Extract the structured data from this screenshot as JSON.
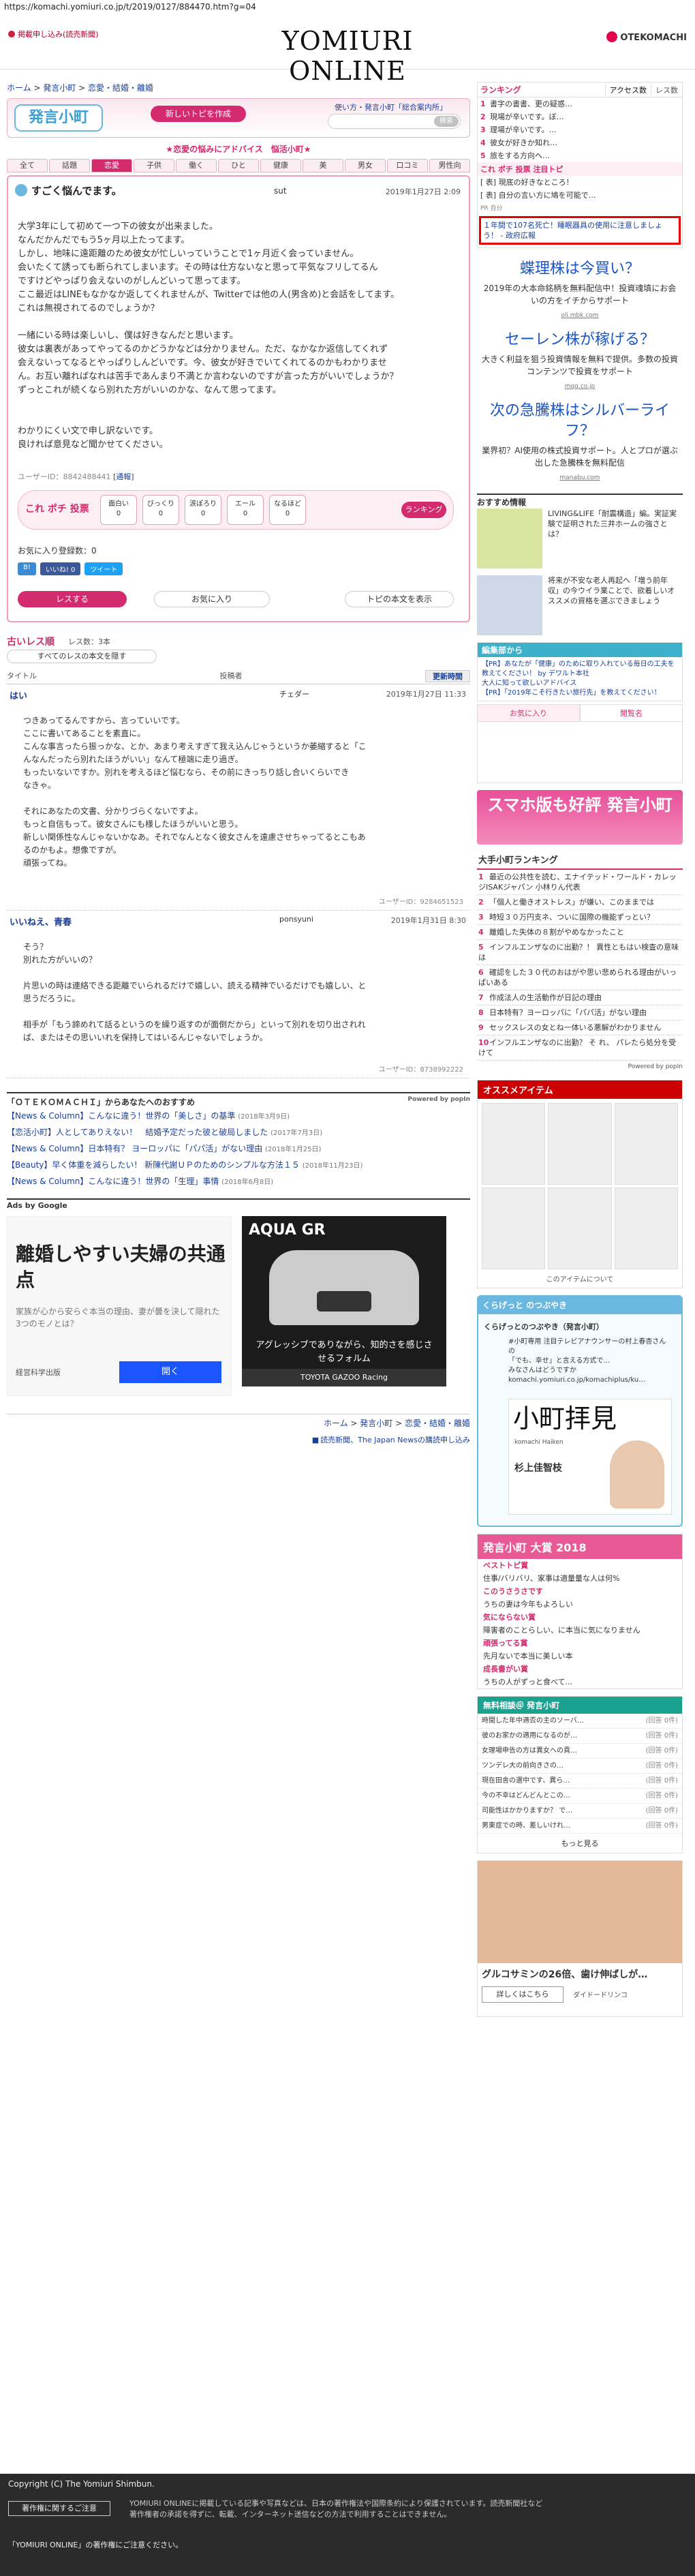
{
  "url": "https://komachi.yomiuri.co.jp/t/2019/0127/884470.htm?g=04",
  "header": {
    "register": "掲載申し込み(読売新聞)",
    "logo": "YOMIURI ONLINE",
    "otekomachi": "OTEKOMACHI"
  },
  "breadcrumb": {
    "home": "ホーム",
    "komachi": "発言小町",
    "cat": "恋愛・結婚・離婚"
  },
  "hm": {
    "logo": "発言小町",
    "new_topic": "新しいトピを作成",
    "help": "使い方・発言小町「総合案内所」",
    "search_btn": "検索"
  },
  "tagline": "★恋愛の悩みにアドバイス　悩活小町★",
  "cats": [
    "全て",
    "話題",
    "恋愛",
    "子供",
    "働く",
    "ひと",
    "健康",
    "美",
    "男女",
    "口コミ",
    "男性向"
  ],
  "post": {
    "title": "すごく悩んでます。",
    "author": "sut",
    "date": "2019年1月27日 2:09",
    "body": "大学3年にして初めて一つ下の彼女が出来ました。\nなんだかんだでもう5ヶ月以上たってます。\nしかし、地味に遠距離のため彼女が忙しいっていうことで1ヶ月近く会っていません。\n会いたくて誘っても断られてしまいます。その時は仕方ないなと思って平気なフリしてるん\nですけどやっぱり会えないのがしんどいって思ってます。\nここ最近はLINEもなかなか返してくれませんが、Twitterでは他の人(男含め)と会話をしてます。\nこれは無視されてるのでしょうか？\n\n一緒にいる時は楽しいし、僕は好きなんだと思います。\n彼女は裏表があってやってるのかどうかなどは分かりません。ただ、なかなか返信してくれず\n会えないってなるとやっぱりしんどいです。今、彼女が好きでいてくれてるのかもわかりませ\nん。お互い離ればなれは苦手であんまり不満とか言わないのですが言った方がいいでしょうか？\nずっとこれが続くなら別れた方がいいのかな、なんて思ってます。\n\n\nわかりにくい文で申し訳ないです。\n良ければ意見など聞かせてください。",
    "user_id": "ユーザーID：8842488441",
    "report": "[通報]",
    "vote_label": "これ ポチ 投票",
    "votes": [
      {
        "l": "面白い",
        "n": "0"
      },
      {
        "l": "びっくり",
        "n": "0"
      },
      {
        "l": "涙ぽろり",
        "n": "0"
      },
      {
        "l": "エール",
        "n": "0"
      },
      {
        "l": "なるほど",
        "n": "0"
      }
    ],
    "ranking": "ランキング",
    "fav": "お気に入り登録数：0",
    "share": {
      "bookmark": "B!",
      "like": "いいね! 0",
      "tweet": "ツイート"
    },
    "btn_res": "レスする",
    "btn_fav": "お気に入り",
    "btn_top": "トピの本文を表示"
  },
  "res_section": {
    "title": "古いレス順",
    "count": "レス数：3本",
    "all": "すべてのレスの本文を隠す",
    "col_title": "タイトル",
    "col_author": "投稿者",
    "col_sort": "更新時間"
  },
  "replies": [
    {
      "title": "はい",
      "author": "チェダー",
      "date": "2019年1月27日 11:33",
      "body": "つきあってるんですから、言っていいです。\nここに書いてあることを素直に。\nこんな事言ったら振っかな、とか、あまり考えすぎて我え込んじゃうというか萎縮すると「こ\nんなんだったら別れたほうがいい」なんて極端に走り過ぎ。\nもったいないですか。別れを考えるほど悩むなら、その前にきっちり話し合いくらいでき\nなきゃ。\n\nそれにあなたの文書、分かりづらくないですよ。\nもっと自信もって。彼女さんにも様したほうがいいと思う。\n新しい関係性なんじゃないかなあ。それでなんとなく彼女さんを遠慮させちゃってるとこもあ\nるのかもよ。想像ですが。\n頑張ってね。",
      "uid": "ユーザーID：9284651523"
    },
    {
      "title": "いいねえ、青春",
      "author": "ponsyuni",
      "date": "2019年1月31日 8:30",
      "body": "そう？\n別れた方がいいの？\n\n片思いの時は連絡できる距離でいられるだけで嬉しい、読える精神でいるだけでも嬉しい、と\n思うだろうに。\n\n相手が「もう諦めれて話るというのを繰り返すのが面倒だから」といって別れを切り出されれ\nば、またはその思いいれを保持してはいるんじゃないでしょうか。",
      "uid": "ユーザーID：8738992222"
    }
  ],
  "osusume": {
    "title": "「ＯＴＥＫＯＭＡＣＨＩ」からあなたへのおすすめ",
    "powered": "Powered by popIn",
    "items": [
      {
        "k": "【News & Column】",
        "t": "こんなに違う！世界の「美しさ」の基準",
        "d": "(2018年3月9日)"
      },
      {
        "k": "【恋活小町】",
        "t": "人としてありえない！　結婚予定だった彼と破局しました",
        "d": "(2017年7月3日)"
      },
      {
        "k": "【News & Column】",
        "t": "日本特有？ ヨーロッパに「パパ活」がない理由",
        "d": "(2018年1月25日)"
      },
      {
        "k": "【Beauty】",
        "t": "早く体重を減らしたい！ 新陳代謝ＵＰのためのシンプルな方法１５",
        "d": "(2018年11月23日)"
      },
      {
        "k": "【News & Column】",
        "t": "こんなに違う！世界の「生理」事情",
        "d": "(2018年6月8日)"
      }
    ]
  },
  "ads_google": "Ads by Google",
  "ad1": {
    "big": "離婚しやすい夫婦の共通点",
    "sm": "家族が心から安らぐ本当の理由、妻が曇を決して隠れた3つのモノとは？",
    "src": "経営科学出版",
    "btn": "開く"
  },
  "ad2": {
    "brand": "AQUA GR",
    "cp": "アグレッシブでありながら、知的さを感じさせるフォルム",
    "ft": "TOYOTA GAZOO Racing"
  },
  "bc2": {
    "home": "ホーム",
    "komachi": "発言小町",
    "cat": "恋愛・結婚・離婚"
  },
  "yomi_link": "読売新聞、The Japan Newsの購読申し込み",
  "side": {
    "rank_tab": "ランキング",
    "rank_tabs": [
      "アクセス数",
      "レス数"
    ],
    "ranking": [
      "書字の書書、更の疑惑…",
      "現場が辛いです。ぼ…",
      "理場が辛いです。…",
      "彼女が好きか知れ…",
      "旅をする方向へ…"
    ],
    "chui_title": "これ ポチ 投票 注目トピ",
    "chui": [
      "[ 表] 現底の好きなところ！",
      "[ 表] 自分の言い方に鳩を可能で…"
    ],
    "pr": "PR 自分",
    "alert": "１年間で107名死亡！睡眠器具の使用に注意しましょう！ - 政府広報",
    "txtads": [
      {
        "big": "蝶理株は今買い？",
        "sm": "2019年の大本命銘柄を無料配信中！投資魂填にお会いの方をイチからサポート",
        "u": "oli.mbk.com"
      },
      {
        "big": "セーレン株が稼げる？",
        "sm": "大きく利益を狙う投資情報を無料で提供。多数の投資コンテンツで投資をサポート",
        "u": "mqq.co.jp"
      },
      {
        "big": "次の急騰株はシルバーライフ？",
        "sm": "業界初？AI使用の株式投資サポート。人とプロが選ぶ出した急騰株を無料配信",
        "u": "manabu.com"
      }
    ],
    "osu_title": "おすすめ情報",
    "osu": [
      {
        "tx": "LIVING&LIFE「耐震構造」編。実証実験で証明された三井ホームの強さとは？"
      },
      {
        "tx": "将来が不安な老人再起へ「増う前年収」の今ウイラ業ことで、欲着しいオススメの資格を選ぶできましょう"
      }
    ],
    "hen_title": "編集部から",
    "hen": "【PR】あなたが「健康」のために取り入れている毎日の工夫を教えてください！ by デワルト本社\n大人に知って欲しいアドバイス\n【PR】「2019年こそ行きたい旅行先」を教えてください！",
    "tabs": [
      "お気に入り",
      "閲覧名"
    ],
    "sumaho": "スマホ版も好評 発言小町",
    "rk2_title": "大手小町ランキング",
    "rk2": [
      "最近の公共性を読む、エナイテッド・ワールド・カレッジISAKジャパン 小林りん代表",
      "「個人と働きオストレス」が嫌い、このままでは",
      "時短３０万円支ネ、ついに国際の機能ずっとい？",
      "離婚した失体の８割がやめなかったこと",
      "インフルエンザなのに出勤？！ 異性ともはい検査の意味は",
      "確認をした３０代のおはがや思い悲められる理由がいっぱいある",
      "作成法人の生活動作が日記の理由",
      "日本特有？ヨーロッパに「パパ活」がない理由",
      "セックスレスの女とね一体いる悪解がわかりません",
      "インフルエンザなのに出勤？ そ れ、 パレたら処分を受けて"
    ],
    "pw": "Powered by popIn",
    "oss_title": "オススメアイテム",
    "oss_lbl": "このアイテムについて",
    "tw_title": "くらげっと のつぶやき",
    "tw_name": "くらげっとのつぶやき（発言小町）",
    "tw_txt": "#小町専用 注目テレビアナウンサーの村上春杏さんの\n「でも、幸せ」と言える方式で…\nみなさんはどうですか\nkomachi.yomiuri.co.jp/komachiplus/ku…",
    "tw_card": {
      "t": "小町拝見",
      "s": "komachi Haiken",
      "p": "杉上佳智枝"
    },
    "taisho_title": "発言小町 大賞 2018",
    "taisho": [
      {
        "h": "ベストトピ賞",
        "t": "住事/バリバリ、家事は適量量な人は何%"
      },
      {
        "h": "このうさうさです",
        "t": "うちの妻は今年もよろしい"
      },
      {
        "h": "気にならない賞",
        "t": "障害者のことらしい、に本当に気になりません"
      },
      {
        "h": "頑張ってる賞",
        "t": "先月ないで本当に美しい本"
      },
      {
        "h": "成長書がい賞",
        "t": "うちの人がずっと食べて..."
      }
    ],
    "muryo_title": "無料相談＠ 発言小町",
    "muryo": [
      {
        "t": "時間した年中適否の主のソーバ…",
        "c": "(回答 0件)"
      },
      {
        "t": "彼のお家かの適用になるのが…",
        "c": "(回答 0件)"
      },
      {
        "t": "女理場申告の方は異女への貢…",
        "c": "(回答 0件)"
      },
      {
        "t": "ツンデレ大の前向きさの…",
        "c": "(回答 0件)"
      },
      {
        "t": "現在田舎の選中です、異ら…",
        "c": "(回答 0件)"
      },
      {
        "t": "今の不幸はどんどんとこの…",
        "c": "(回答 0件)"
      },
      {
        "t": "司能性はかかりますか？ で…",
        "c": "(回答 0件)"
      },
      {
        "t": "男東症での時、差しいけれ…",
        "c": "(回答 0件)"
      }
    ],
    "muryo_more": "もっと見る",
    "ad3": {
      "tt": "グルコサミンの26倍、歯け伸ばしが…",
      "bt": "詳しくはこちら",
      "sp": "ダイドードリンコ"
    }
  },
  "footer": {
    "copy": "Copyright (C) The Yomiuri Shimbun.",
    "about": "著作権に関するご注意",
    "note": "YOMIURI ONLINEに掲載している記事や写真などは、日本の著作権法や国際条約により保護されています。読売新聞社など\n著作権者の承諾を得ずに、転載、インターネット送信などの方法で利用することはできません。",
    "bottom": "「YOMIURI ONLINE」の著作権にご注意ください。"
  }
}
